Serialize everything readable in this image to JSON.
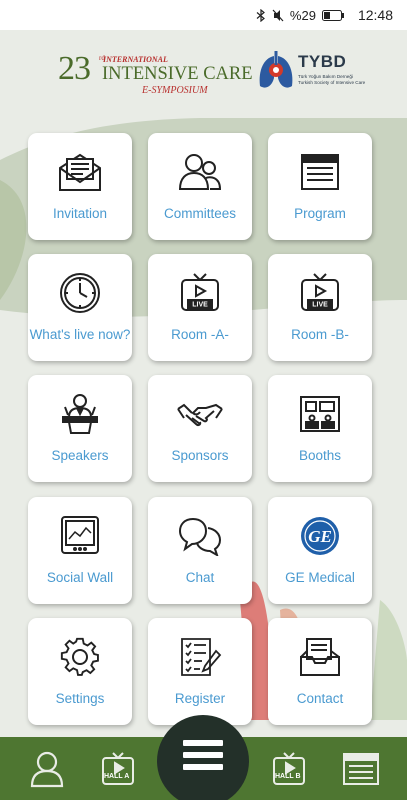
{
  "status_bar": {
    "battery": "%29",
    "time": "12:48",
    "icons": [
      "bluetooth-icon",
      "mute-icon",
      "battery-icon"
    ]
  },
  "header": {
    "event_logo": {
      "number": "23",
      "ordinal": "rd",
      "line_top": "INTERNATIONAL",
      "line_main": "INTENSIVE CARE",
      "line_bottom": "E-SYMPOSIUM"
    },
    "society_logo": {
      "acronym": "TYBD",
      "subtitle_tr": "Türk Yoğun Bakım Derneği",
      "subtitle_en": "Turkish Society of Intensive Care"
    }
  },
  "tiles": [
    {
      "label": "Invitation",
      "icon": "envelope-icon"
    },
    {
      "label": "Committees",
      "icon": "people-icon"
    },
    {
      "label": "Program",
      "icon": "program-list-icon"
    },
    {
      "label": "What's live now?",
      "icon": "clock-icon"
    },
    {
      "label": "Room -A-",
      "icon": "live-tv-icon"
    },
    {
      "label": "Room -B-",
      "icon": "live-tv-icon"
    },
    {
      "label": "Speakers",
      "icon": "speaker-podium-icon"
    },
    {
      "label": "Sponsors",
      "icon": "handshake-icon"
    },
    {
      "label": "Booths",
      "icon": "booths-icon"
    },
    {
      "label": "Social Wall",
      "icon": "monitor-chart-icon"
    },
    {
      "label": "Chat",
      "icon": "chat-bubbles-icon"
    },
    {
      "label": "GE Medical",
      "icon": "ge-logo-icon"
    },
    {
      "label": "Settings",
      "icon": "gear-icon"
    },
    {
      "label": "Register",
      "icon": "checklist-icon"
    },
    {
      "label": "Contact",
      "icon": "mail-tray-icon"
    }
  ],
  "bottom_bar": {
    "hall_a_label": "HALL A",
    "hall_b_label": "HALL B",
    "icons": [
      "profile-icon",
      "hall-a-tv-icon",
      "menu-icon",
      "hall-b-tv-icon",
      "program-list-icon"
    ]
  },
  "colors": {
    "label_blue": "#4a9ad0",
    "brand_green": "#4e7631",
    "menu_dark": "#233029",
    "logo_red": "#b8312f"
  }
}
